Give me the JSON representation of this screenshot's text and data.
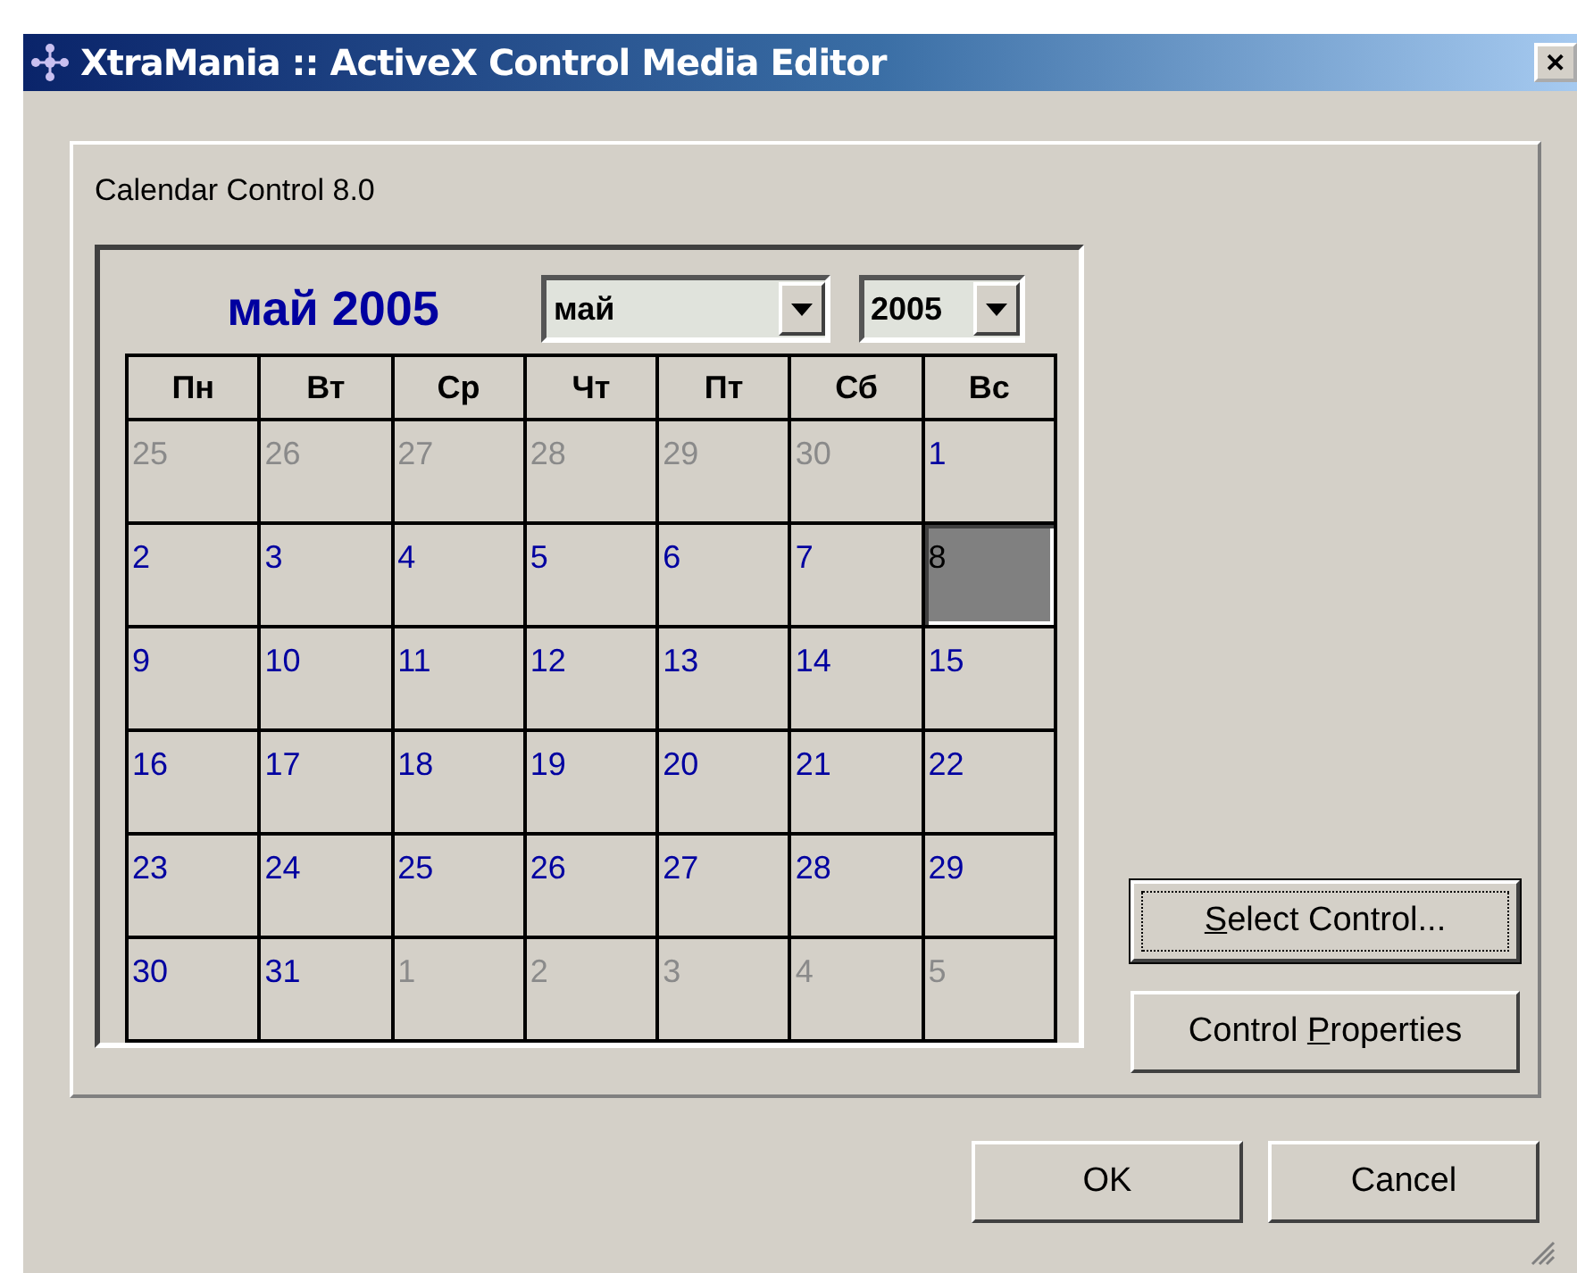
{
  "window": {
    "title": "XtraMania :: ActiveX Control Media Editor",
    "close": "✕"
  },
  "group_label": "Calendar Control 8.0",
  "calendar": {
    "heading": "май 2005",
    "month_select": {
      "value": "май"
    },
    "year_select": {
      "value": "2005"
    },
    "weekdays": [
      "Пн",
      "Вт",
      "Ср",
      "Чт",
      "Пт",
      "Сб",
      "Вс"
    ],
    "weeks": [
      [
        {
          "day": "25",
          "other_month": true,
          "selected": false
        },
        {
          "day": "26",
          "other_month": true,
          "selected": false
        },
        {
          "day": "27",
          "other_month": true,
          "selected": false
        },
        {
          "day": "28",
          "other_month": true,
          "selected": false
        },
        {
          "day": "29",
          "other_month": true,
          "selected": false
        },
        {
          "day": "30",
          "other_month": true,
          "selected": false
        },
        {
          "day": "1",
          "other_month": false,
          "selected": false
        }
      ],
      [
        {
          "day": "2",
          "other_month": false,
          "selected": false
        },
        {
          "day": "3",
          "other_month": false,
          "selected": false
        },
        {
          "day": "4",
          "other_month": false,
          "selected": false
        },
        {
          "day": "5",
          "other_month": false,
          "selected": false
        },
        {
          "day": "6",
          "other_month": false,
          "selected": false
        },
        {
          "day": "7",
          "other_month": false,
          "selected": false
        },
        {
          "day": "8",
          "other_month": false,
          "selected": true
        }
      ],
      [
        {
          "day": "9",
          "other_month": false,
          "selected": false
        },
        {
          "day": "10",
          "other_month": false,
          "selected": false
        },
        {
          "day": "11",
          "other_month": false,
          "selected": false
        },
        {
          "day": "12",
          "other_month": false,
          "selected": false
        },
        {
          "day": "13",
          "other_month": false,
          "selected": false
        },
        {
          "day": "14",
          "other_month": false,
          "selected": false
        },
        {
          "day": "15",
          "other_month": false,
          "selected": false
        }
      ],
      [
        {
          "day": "16",
          "other_month": false,
          "selected": false
        },
        {
          "day": "17",
          "other_month": false,
          "selected": false
        },
        {
          "day": "18",
          "other_month": false,
          "selected": false
        },
        {
          "day": "19",
          "other_month": false,
          "selected": false
        },
        {
          "day": "20",
          "other_month": false,
          "selected": false
        },
        {
          "day": "21",
          "other_month": false,
          "selected": false
        },
        {
          "day": "22",
          "other_month": false,
          "selected": false
        }
      ],
      [
        {
          "day": "23",
          "other_month": false,
          "selected": false
        },
        {
          "day": "24",
          "other_month": false,
          "selected": false
        },
        {
          "day": "25",
          "other_month": false,
          "selected": false
        },
        {
          "day": "26",
          "other_month": false,
          "selected": false
        },
        {
          "day": "27",
          "other_month": false,
          "selected": false
        },
        {
          "day": "28",
          "other_month": false,
          "selected": false
        },
        {
          "day": "29",
          "other_month": false,
          "selected": false
        }
      ],
      [
        {
          "day": "30",
          "other_month": false,
          "selected": false
        },
        {
          "day": "31",
          "other_month": false,
          "selected": false
        },
        {
          "day": "1",
          "other_month": true,
          "selected": false
        },
        {
          "day": "2",
          "other_month": true,
          "selected": false
        },
        {
          "day": "3",
          "other_month": true,
          "selected": false
        },
        {
          "day": "4",
          "other_month": true,
          "selected": false
        },
        {
          "day": "5",
          "other_month": true,
          "selected": false
        }
      ]
    ]
  },
  "side_buttons": [
    {
      "label_parts": [
        {
          "text": "S",
          "underlined": true
        },
        {
          "text": "elect Control...",
          "underlined": false
        }
      ],
      "default": true
    },
    {
      "label_parts": [
        {
          "text": "Control ",
          "underlined": false
        },
        {
          "text": "P",
          "underlined": true
        },
        {
          "text": "roperties",
          "underlined": false
        }
      ],
      "default": false
    }
  ],
  "buttons": [
    {
      "label": "OK"
    },
    {
      "label": "Cancel"
    }
  ]
}
